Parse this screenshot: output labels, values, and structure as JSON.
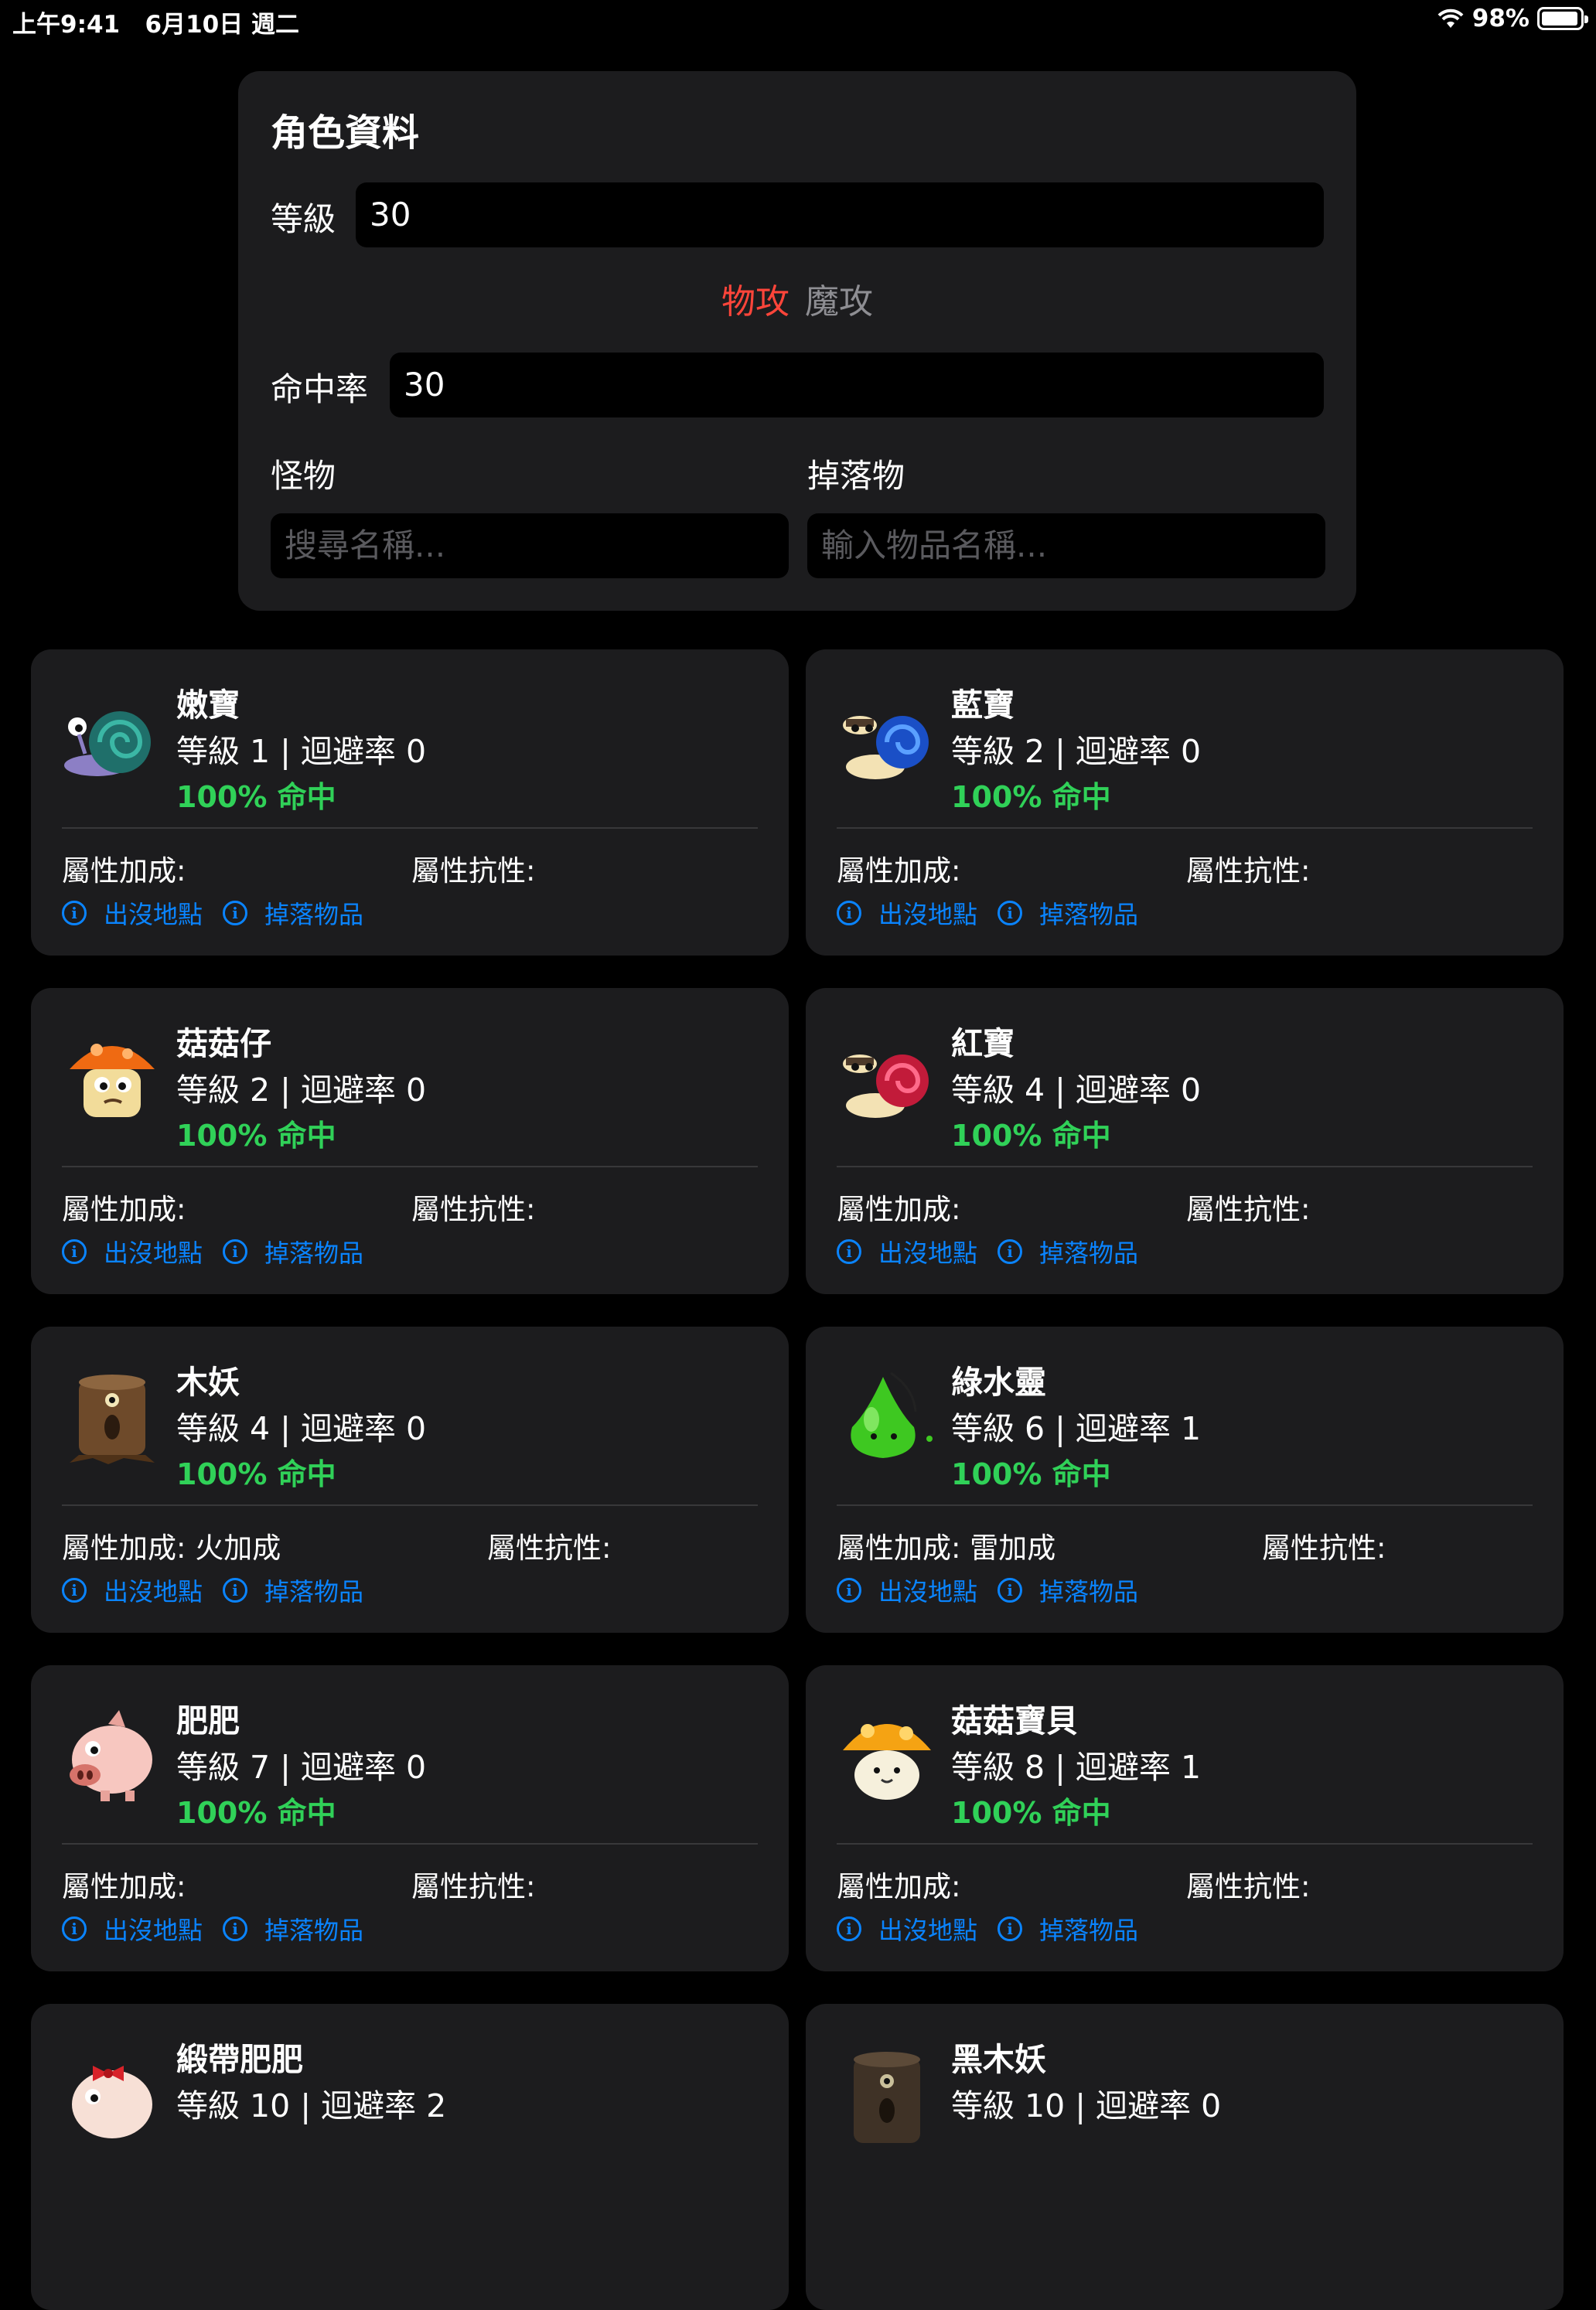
{
  "status": {
    "time": "上午9:41",
    "date": "6月10日 週二",
    "battery": "98%"
  },
  "profile": {
    "title": "角色資料",
    "level_label": "等級",
    "level_value": "30",
    "atk_phys": "物攻",
    "atk_magic": "魔攻",
    "accuracy_label": "命中率",
    "accuracy_value": "30",
    "monster_label": "怪物",
    "drop_label": "掉落物",
    "monster_placeholder": "搜尋名稱...",
    "drop_placeholder": "輸入物品名稱..."
  },
  "common": {
    "attr_bonus": "屬性加成:",
    "attr_resist": "屬性抗性:",
    "spawn_link": "出沒地點",
    "drop_link": "掉落物品"
  },
  "monsters": [
    {
      "name": "嫩寶",
      "meta": "等級 1 | 迴避率 0",
      "hit": "100% 命中",
      "bonus": "屬性加成:",
      "resist": "屬性抗性:",
      "sprite": "green-snail"
    },
    {
      "name": "藍寶",
      "meta": "等級 2 | 迴避率 0",
      "hit": "100% 命中",
      "bonus": "屬性加成:",
      "resist": "屬性抗性:",
      "sprite": "blue-snail"
    },
    {
      "name": "菇菇仔",
      "meta": "等級 2 | 迴避率 0",
      "hit": "100% 命中",
      "bonus": "屬性加成:",
      "resist": "屬性抗性:",
      "sprite": "orange-mushroom"
    },
    {
      "name": "紅寶",
      "meta": "等級 4 | 迴避率 0",
      "hit": "100% 命中",
      "bonus": "屬性加成:",
      "resist": "屬性抗性:",
      "sprite": "red-snail"
    },
    {
      "name": "木妖",
      "meta": "等級 4 | 迴避率 0",
      "hit": "100% 命中",
      "bonus": "屬性加成: 火加成",
      "resist": "屬性抗性:",
      "sprite": "stump"
    },
    {
      "name": "綠水靈",
      "meta": "等級 6 | 迴避率 1",
      "hit": "100% 命中",
      "bonus": "屬性加成: 雷加成",
      "resist": "屬性抗性:",
      "sprite": "green-slime"
    },
    {
      "name": "肥肥",
      "meta": "等級 7 | 迴避率 0",
      "hit": "100% 命中",
      "bonus": "屬性加成:",
      "resist": "屬性抗性:",
      "sprite": "pig"
    },
    {
      "name": "菇菇寶貝",
      "meta": "等級 8 | 迴避率 1",
      "hit": "100% 命中",
      "bonus": "屬性加成:",
      "resist": "屬性抗性:",
      "sprite": "yellow-mushroom"
    },
    {
      "name": "緞帶肥肥",
      "meta": "等級 10 | 迴避率 2",
      "hit": "",
      "bonus": "",
      "resist": "",
      "sprite": "ribbon-pig"
    },
    {
      "name": "黑木妖",
      "meta": "等級 10 | 迴避率 0",
      "hit": "",
      "bonus": "",
      "resist": "",
      "sprite": "dark-stump"
    }
  ]
}
